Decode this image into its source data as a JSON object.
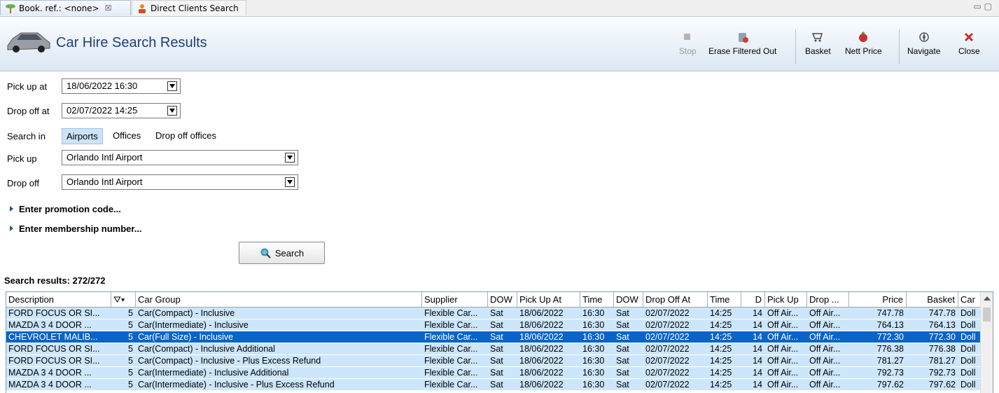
{
  "tabs": [
    {
      "label": "Book. ref.: <none>",
      "close": "☒"
    },
    {
      "label": "Direct Clients Search"
    }
  ],
  "header": {
    "title": "Car Hire Search Results"
  },
  "toolbar": {
    "stop": "Stop",
    "erase": "Erase Filtered Out",
    "basket": "Basket",
    "nett_price": "Nett Price",
    "navigate": "Navigate",
    "close": "Close"
  },
  "form": {
    "pickup_at_label": "Pick up at",
    "pickup_at_value": "18/06/2022 16:30",
    "dropoff_at_label": "Drop off at",
    "dropoff_at_value": "02/07/2022 14:25",
    "search_in_label": "Search in",
    "search_in_options": [
      "Airports",
      "Offices",
      "Drop off offices"
    ],
    "search_in_selected": "Airports",
    "pickup_label": "Pick up",
    "pickup_value": "Orlando Intl Airport",
    "dropoff_label": "Drop off",
    "dropoff_value": "Orlando Intl Airport",
    "promo": "Enter promotion code...",
    "membership": "Enter membership number...",
    "search_button": "Search"
  },
  "results": {
    "label": "Search results: 272/272",
    "columns": [
      "Description",
      "",
      "Car Group",
      "Supplier",
      "DOW",
      "Pick Up At",
      "Time",
      "DOW",
      "Drop Off At",
      "Time",
      "D",
      "Pick Up",
      "Drop ...",
      "Price",
      "Basket",
      "Car"
    ],
    "rows": [
      [
        "FORD FOCUS OR SI...",
        "5",
        "Car(Compact) - Inclusive",
        "Flexible Car...",
        "Sat",
        "18/06/2022",
        "16:30",
        "Sat",
        "02/07/2022",
        "14:25",
        "14",
        "Off Air...",
        "Off Air...",
        "747.78",
        "747.78",
        "Doll"
      ],
      [
        "MAZDA 3 4 DOOR ...",
        "5",
        "Car(Intermediate) - Inclusive",
        "Flexible Car...",
        "Sat",
        "18/06/2022",
        "16:30",
        "Sat",
        "02/07/2022",
        "14:25",
        "14",
        "Off Air...",
        "Off Air...",
        "764.13",
        "764.13",
        "Doll"
      ],
      [
        "CHEVROLET MALIB...",
        "5",
        "Car(Full Size) - Inclusive",
        "Flexible Car...",
        "Sat",
        "18/06/2022",
        "16:30",
        "Sat",
        "02/07/2022",
        "14:25",
        "14",
        "Off Air...",
        "Off Air...",
        "772.30",
        "772.30",
        "Doll"
      ],
      [
        "FORD FOCUS OR SI...",
        "5",
        "Car(Compact) - Inclusive Additional",
        "Flexible Car...",
        "Sat",
        "18/06/2022",
        "16:30",
        "Sat",
        "02/07/2022",
        "14:25",
        "14",
        "Off Air...",
        "Off Air...",
        "776.38",
        "776.38",
        "Doll"
      ],
      [
        "FORD FOCUS OR SI...",
        "5",
        "Car(Compact) - Inclusive - Plus Excess Refund",
        "Flexible Car...",
        "Sat",
        "18/06/2022",
        "16:30",
        "Sat",
        "02/07/2022",
        "14:25",
        "14",
        "Off Air...",
        "Off Air...",
        "781.27",
        "781.27",
        "Doll"
      ],
      [
        "MAZDA 3 4 DOOR ...",
        "5",
        "Car(Intermediate) - Inclusive Additional",
        "Flexible Car...",
        "Sat",
        "18/06/2022",
        "16:30",
        "Sat",
        "02/07/2022",
        "14:25",
        "14",
        "Off Air...",
        "Off Air...",
        "792.73",
        "792.73",
        "Doll"
      ],
      [
        "MAZDA 3 4 DOOR ...",
        "5",
        "Car(Intermediate) - Inclusive - Plus Excess Refund",
        "Flexible Car...",
        "Sat",
        "18/06/2022",
        "16:30",
        "Sat",
        "02/07/2022",
        "14:25",
        "14",
        "Off Air...",
        "Off Air...",
        "797.62",
        "797.62",
        "Doll"
      ]
    ],
    "selected_row": 2
  }
}
